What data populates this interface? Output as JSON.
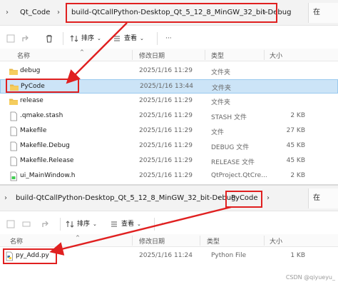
{
  "top": {
    "breadcrumbs": [
      "Qt_Code",
      "build-QtCallPython-Desktop_Qt_5_12_8_MinGW_32_bit-Debug"
    ],
    "search": "在",
    "toolbar": {
      "sort": "排序",
      "view": "查看"
    },
    "headers": {
      "name": "名称",
      "date": "修改日期",
      "type": "类型",
      "size": "大小"
    },
    "files": [
      {
        "name": "debug",
        "date": "2025/1/16 11:29",
        "type": "文件夹",
        "size": "",
        "icon": "folder-icon"
      },
      {
        "name": "PyCode",
        "date": "2025/1/16 13:44",
        "type": "文件夹",
        "size": "",
        "icon": "folder-icon"
      },
      {
        "name": "release",
        "date": "2025/1/16 11:29",
        "type": "文件夹",
        "size": "",
        "icon": "folder-icon"
      },
      {
        "name": ".qmake.stash",
        "date": "2025/1/16 11:29",
        "type": "STASH 文件",
        "size": "2 KB",
        "icon": "file-icon"
      },
      {
        "name": "Makefile",
        "date": "2025/1/16 11:29",
        "type": "文件",
        "size": "27 KB",
        "icon": "file-icon"
      },
      {
        "name": "Makefile.Debug",
        "date": "2025/1/16 11:29",
        "type": "DEBUG 文件",
        "size": "45 KB",
        "icon": "file-icon"
      },
      {
        "name": "Makefile.Release",
        "date": "2025/1/16 11:29",
        "type": "RELEASE 文件",
        "size": "45 KB",
        "icon": "file-icon"
      },
      {
        "name": "ui_MainWindow.h",
        "date": "2025/1/16 11:29",
        "type": "QtProject.QtCre...",
        "size": "2 KB",
        "icon": "header-file-icon"
      }
    ]
  },
  "bottom": {
    "breadcrumbs": [
      "build-QtCallPython-Desktop_Qt_5_12_8_MinGW_32_bit-Debug",
      "PyCode"
    ],
    "search": "在",
    "toolbar": {
      "sort": "排序",
      "view": "查看"
    },
    "headers": {
      "name": "名称",
      "date": "修改日期",
      "type": "类型",
      "size": "大小"
    },
    "files": [
      {
        "name": "py_Add.py",
        "date": "2025/1/16 11:24",
        "type": "Python File",
        "size": "1 KB",
        "icon": "python-file-icon"
      }
    ]
  },
  "watermark": "CSDN @qiyueyu_",
  "colors": {
    "highlight": "#e02020",
    "selection": "#cce4f7",
    "folder": "#e8b84a"
  }
}
